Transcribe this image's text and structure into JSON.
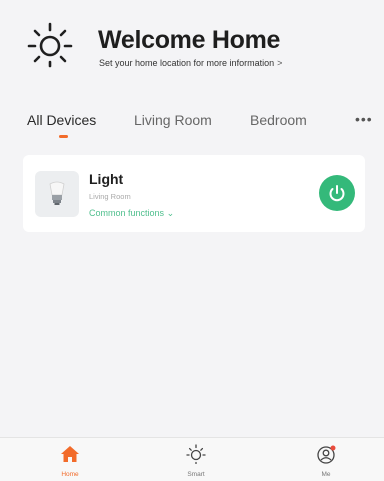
{
  "header": {
    "title": "Welcome Home",
    "subtitle": "Set your home location for more information",
    "subtitle_chevron": ">"
  },
  "tabs": [
    {
      "label": "All Devices",
      "active": true
    },
    {
      "label": "Living Room",
      "active": false
    },
    {
      "label": "Bedroom",
      "active": false
    }
  ],
  "tabs_more": "•••",
  "device": {
    "name": "Light",
    "room": "Living Room",
    "functions_label": "Common functions",
    "functions_chevron": "⌄"
  },
  "bottom_nav": [
    {
      "label": "Home",
      "icon": "home-icon",
      "active": true
    },
    {
      "label": "Smart",
      "icon": "sun-icon",
      "active": false
    },
    {
      "label": "Me",
      "icon": "profile-icon",
      "active": false
    }
  ],
  "colors": {
    "accent": "#f26b2a",
    "power": "#34b97a",
    "link": "#4fbf8d",
    "badge": "#e94b3c"
  }
}
